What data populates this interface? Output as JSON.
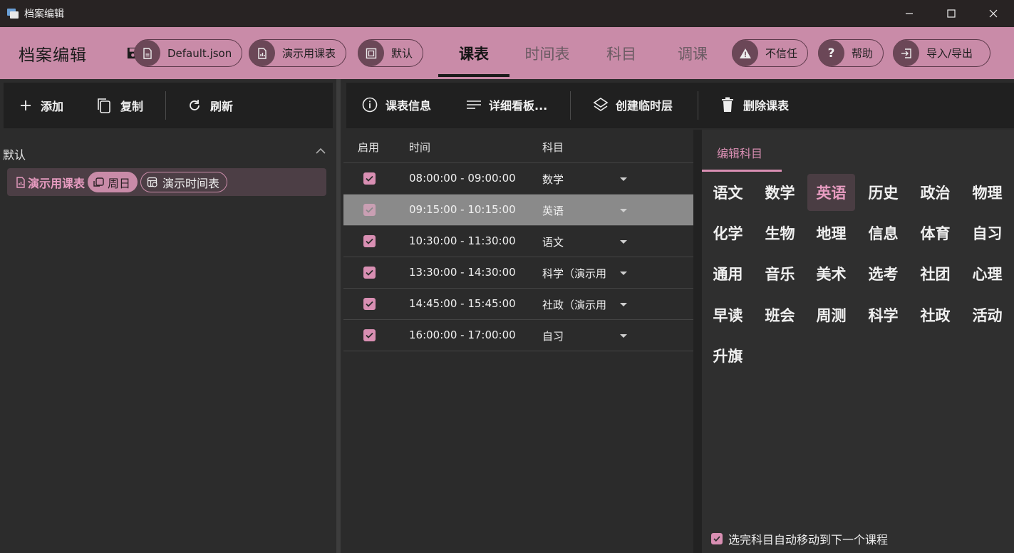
{
  "window": {
    "title": "档案编辑"
  },
  "header": {
    "title": "档案编辑",
    "file_chip": "Default.json",
    "schedule_chip": "演示用课表",
    "group_chip": "默认",
    "tabs": [
      {
        "label": "课表",
        "active": true
      },
      {
        "label": "时间表",
        "active": false
      },
      {
        "label": "科目",
        "active": false
      },
      {
        "label": "调课",
        "active": false
      }
    ],
    "distrust_chip": "不信任",
    "help_chip": "帮助",
    "import_export_chip": "导入/导出"
  },
  "left_toolbar": {
    "add": "添加",
    "copy": "复制",
    "refresh": "刷新"
  },
  "group": {
    "label": "默认",
    "item": {
      "name": "演示用课表",
      "weekday_tag": "周日",
      "timetable_tag": "演示时间表"
    }
  },
  "right_toolbar": {
    "info": "课表信息",
    "detail": "详细看板...",
    "temp_layer": "创建临时层",
    "delete": "删除课表"
  },
  "table": {
    "headers": {
      "enabled": "启用",
      "time": "时间",
      "subject": "科目"
    },
    "rows": [
      {
        "enabled": true,
        "time": "08:00:00 - 09:00:00",
        "subject": "数学",
        "selected": false
      },
      {
        "enabled": true,
        "time": "09:15:00 - 10:15:00",
        "subject": "英语",
        "selected": true
      },
      {
        "enabled": true,
        "time": "10:30:00 - 11:30:00",
        "subject": "语文",
        "selected": false
      },
      {
        "enabled": true,
        "time": "13:30:00 - 14:30:00",
        "subject": "科学（演示用",
        "selected": false
      },
      {
        "enabled": true,
        "time": "14:45:00 - 15:45:00",
        "subject": "社政（演示用",
        "selected": false
      },
      {
        "enabled": true,
        "time": "16:00:00 - 17:00:00",
        "subject": "自习",
        "selected": false
      }
    ]
  },
  "subject_editor": {
    "tab": "编辑科目",
    "subjects": [
      "语文",
      "数学",
      "英语",
      "历史",
      "政治",
      "物理",
      "化学",
      "生物",
      "地理",
      "信息",
      "体育",
      "自习",
      "通用",
      "音乐",
      "美术",
      "选考",
      "社团",
      "心理",
      "早读",
      "班会",
      "周测",
      "科学",
      "社政",
      "活动",
      "升旗"
    ],
    "selected": "英语",
    "auto_move_label": "选完科目自动移动到下一个课程",
    "auto_move_checked": true
  },
  "colors": {
    "accent": "#c98ba8",
    "accent_text": "#d98fb3"
  }
}
